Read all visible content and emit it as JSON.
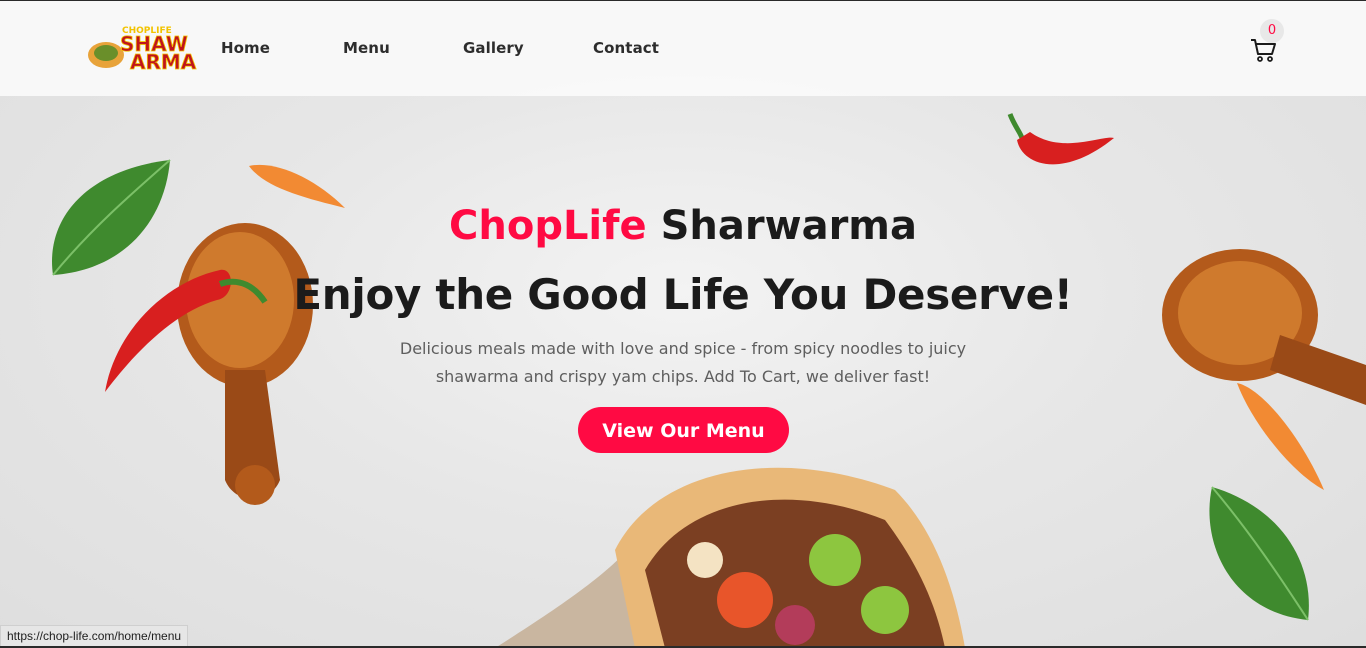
{
  "nav": {
    "logo_text_top": "CHOPLIFE",
    "logo_text_main1": "SHAW",
    "logo_text_main2": "ARMA",
    "links": [
      "Home",
      "Menu",
      "Gallery",
      "Contact"
    ],
    "cart_count": "0"
  },
  "hero": {
    "title_brand": "ChopLife",
    "title_rest": "Sharwarma",
    "headline": "Enjoy the Good Life You Deserve!",
    "description_line1": "Delicious meals made with love and spice - from spicy noodles to juicy",
    "description_line2": "shawarma and crispy yam chips. Add To Cart, we deliver fast!",
    "cta_label": "View Our Menu"
  },
  "status_bar": {
    "url": "https://chop-life.com/home/menu"
  },
  "colors": {
    "accent": "#ff0a43",
    "heading": "#1b1b1b",
    "body_text": "#5e5e5e"
  },
  "icons": [
    "cart-icon",
    "logo-icon"
  ]
}
